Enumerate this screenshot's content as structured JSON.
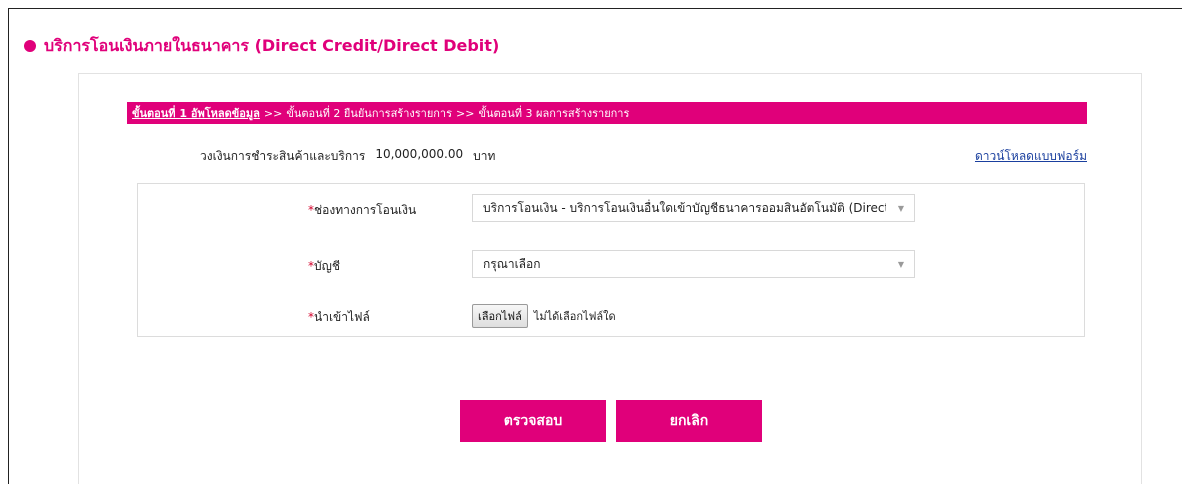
{
  "section": {
    "title": "บริการโอนเงินภายในธนาคาร (Direct Credit/Direct Debit)"
  },
  "steps": {
    "step1": "ขั้นตอนที่ 1 อัพโหลดข้อมูล",
    "sep1": ">>",
    "step2": "ขั้นตอนที่ 2 ยืนยันการสร้างรายการ",
    "sep2": ">>",
    "step3": "ขั้นตอนที่ 3 ผลการสร้างรายการ"
  },
  "limit": {
    "label": "วงเงินการชำระสินค้าและบริการ",
    "amount": "10,000,000.00",
    "unit": "บาท"
  },
  "download_link": "ดาวน์โหลดแบบฟอร์ม",
  "form": {
    "required_mark": "*",
    "channel_label": "ช่องทางการโอนเงิน",
    "channel_value": "บริการโอนเงิน - บริการโอนเงินอื่นใดเข้าบัญชีธนาคารออมสินอัตโนมัติ (Direct",
    "account_label": "บัญชี",
    "account_value": "กรุณาเลือก",
    "file_label": "นำเข้าไฟล์",
    "file_button": "เลือกไฟล์",
    "file_status": "ไม่ได้เลือกไฟล์ใด",
    "caret": "▼"
  },
  "buttons": {
    "check": "ตรวจสอบ",
    "cancel": "ยกเลิก"
  },
  "colors": {
    "accent": "#e0007a",
    "link": "#1a3f9e"
  }
}
